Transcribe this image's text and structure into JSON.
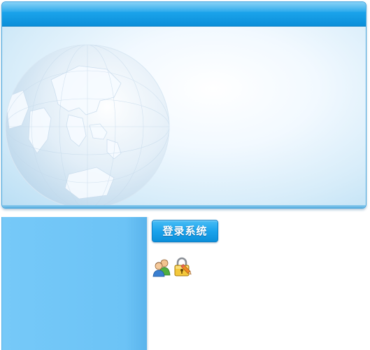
{
  "login": {
    "button_label": "登录系统"
  },
  "icons": {
    "users": "users-icon",
    "lock_edit": "lock-edit-icon",
    "globe": "globe-icon"
  },
  "colors": {
    "header_blue": "#1aa2ea",
    "side_panel": "#6cc3f6",
    "button_blue": "#1ba3ec"
  }
}
